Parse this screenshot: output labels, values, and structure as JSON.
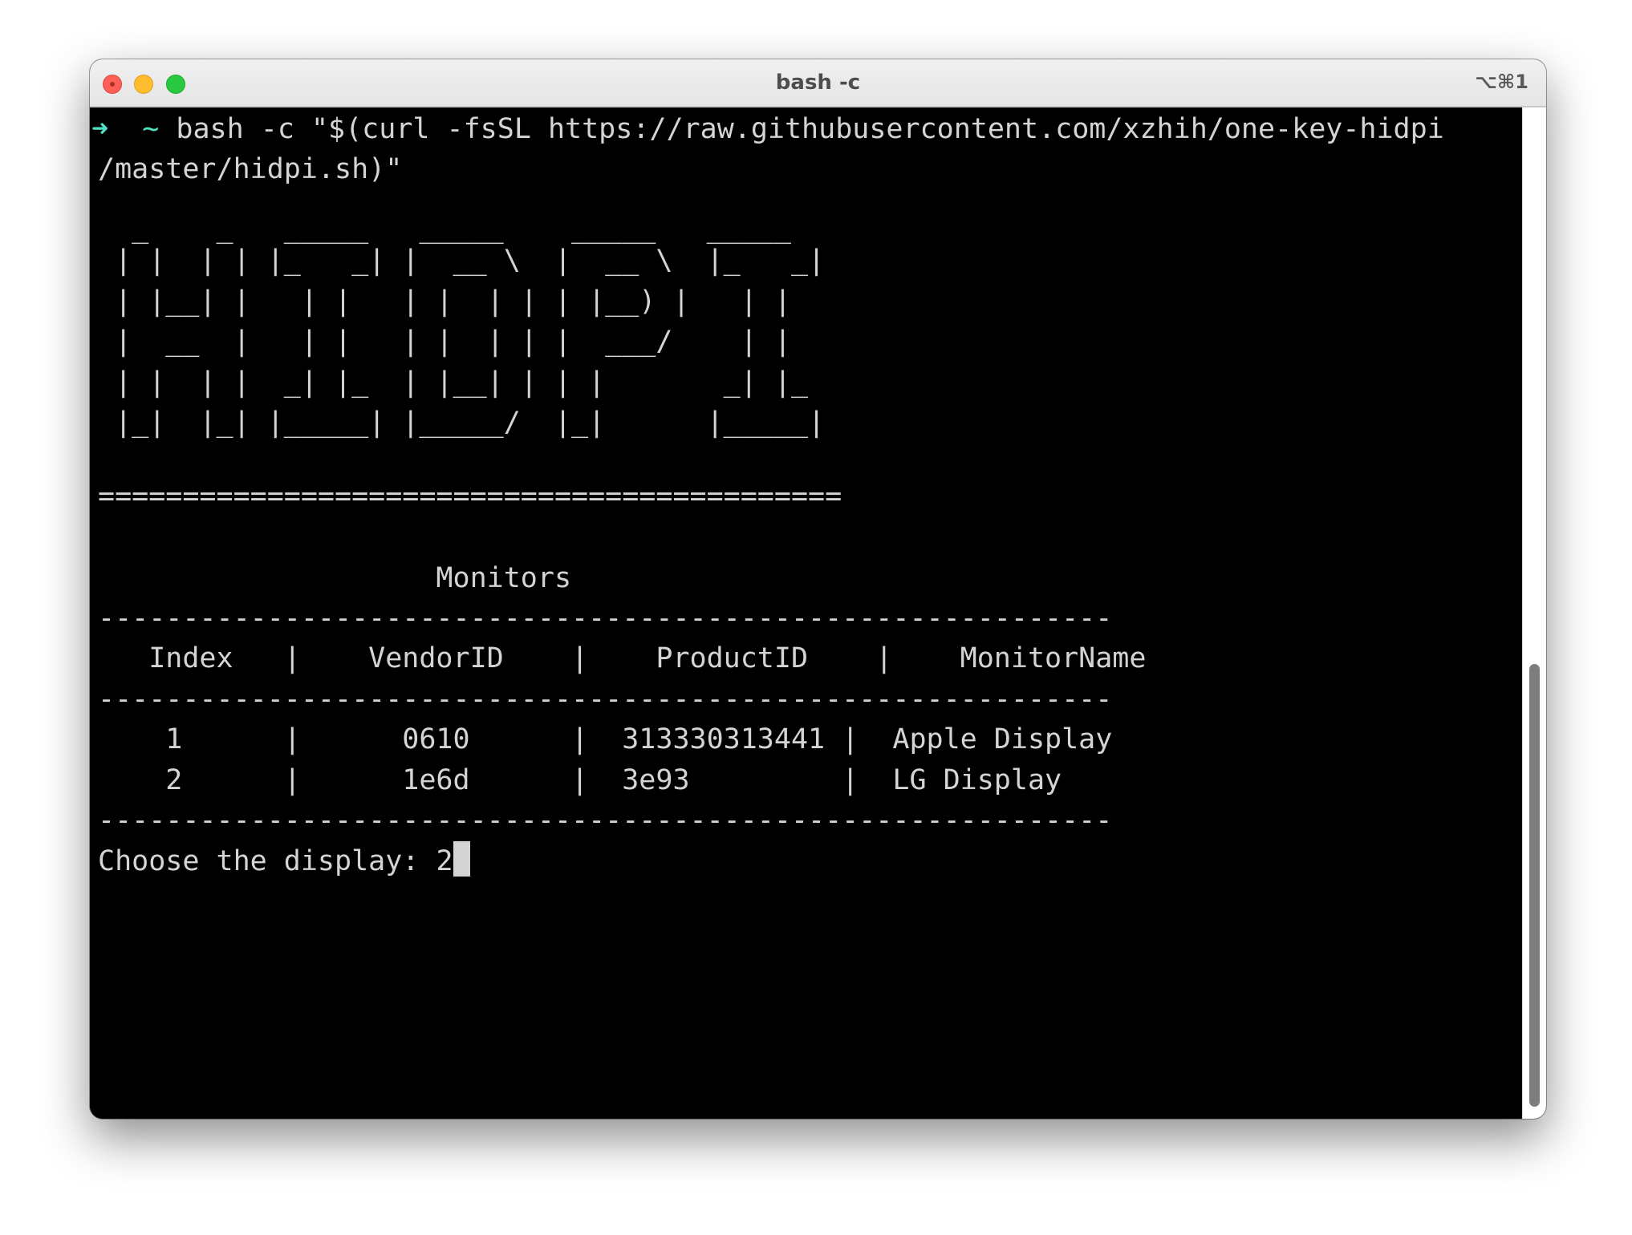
{
  "window": {
    "title": "bash -c",
    "shortcut": "⌥⌘1"
  },
  "terminal": {
    "prompt_arrow": "➜",
    "prompt_dir": "~",
    "command_line_1": "bash -c \"$(curl -fsSL https://raw.githubusercontent.com/xzhih/one-key-hidpi",
    "command_line_2": "/master/hidpi.sh)\"",
    "banner": [
      "  _    _   _____   _____    _____   _____ ",
      " | |  | | |_   _| |  __ \\  |  __ \\  |_   _|",
      " | |__| |   | |   | |  | | | |__) |   | |  ",
      " |  __  |   | |   | |  | | |  ___/    | |  ",
      " | |  | |  _| |_  | |__| | | |       _| |_ ",
      " |_|  |_| |_____| |_____/  |_|      |_____|"
    ],
    "separator_equals": "============================================",
    "monitors_heading": "                    Monitors",
    "table_rule": "------------------------------------------------------------",
    "table_header": "   Index   |    VendorID    |    ProductID    |    MonitorName",
    "table_rows": [
      "    1      |      0610      |  313330313441 |  Apple Display",
      "    2      |      1e6d      |  3e93         |  LG Display"
    ],
    "choose_prompt": "Choose the display: ",
    "choose_input": "2"
  }
}
